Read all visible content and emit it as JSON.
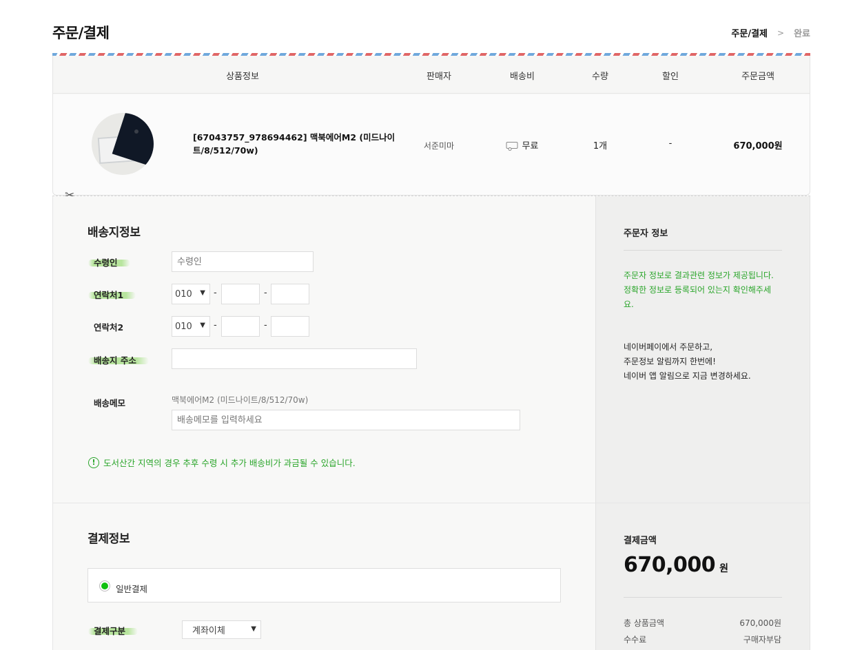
{
  "header": {
    "title": "주문/결제",
    "step_current": "주문/결제",
    "step_next": "완료"
  },
  "table": {
    "columns": [
      "상품정보",
      "판매자",
      "배송비",
      "수량",
      "할인",
      "주문금액"
    ],
    "item": {
      "name": "[67043757_978694462] 맥북에어M2 (미드나이트/8/512/70w)",
      "seller": "서준미마",
      "shipping": "무료",
      "qty": "1개",
      "discount": "-",
      "amount": "670,000원"
    }
  },
  "shipping": {
    "title": "배송지정보",
    "recipient_label": "수령인",
    "recipient_placeholder": "수령인",
    "phone1_label": "연락처1",
    "phone2_label": "연락처2",
    "phone_prefix": "010",
    "address_label": "배송지 주소",
    "memo_label": "배송메모",
    "memo_product": "맥북에어M2 (미드나이트/8/512/70w)",
    "memo_placeholder": "배송메모를 입력하세요",
    "notice": "도서산간 지역의 경우 추후 수령 시 추가 배송비가 과금될 수 있습니다."
  },
  "orderer": {
    "title": "주문자 정보",
    "green_line1": "주문자 정보로 결과관련 정보가 제공됩니다.",
    "green_line2": "정확한 정보로 등록되어 있는지 확인해주세요.",
    "info_line1": "네이버페이에서 주문하고,",
    "info_line2": "주문정보 알림까지 한번에!",
    "info_line3": "네이버 앱 알림으로 지금 변경하세요."
  },
  "payment": {
    "title": "결제정보",
    "method_label": "일반결제",
    "type_label": "결제구분",
    "type_value": "계좌이체",
    "amount_title": "결제금액",
    "amount_value": "670,000",
    "amount_unit": "원",
    "total_label": "총 상품금액",
    "total_value": "670,000원",
    "fee_label": "수수료",
    "fee_value": "구매자부담"
  },
  "colors": {
    "accent_green": "#2aa52a",
    "radio_green": "#10c010",
    "airmail_red": "#e06666",
    "airmail_blue": "#6fa8dc"
  }
}
